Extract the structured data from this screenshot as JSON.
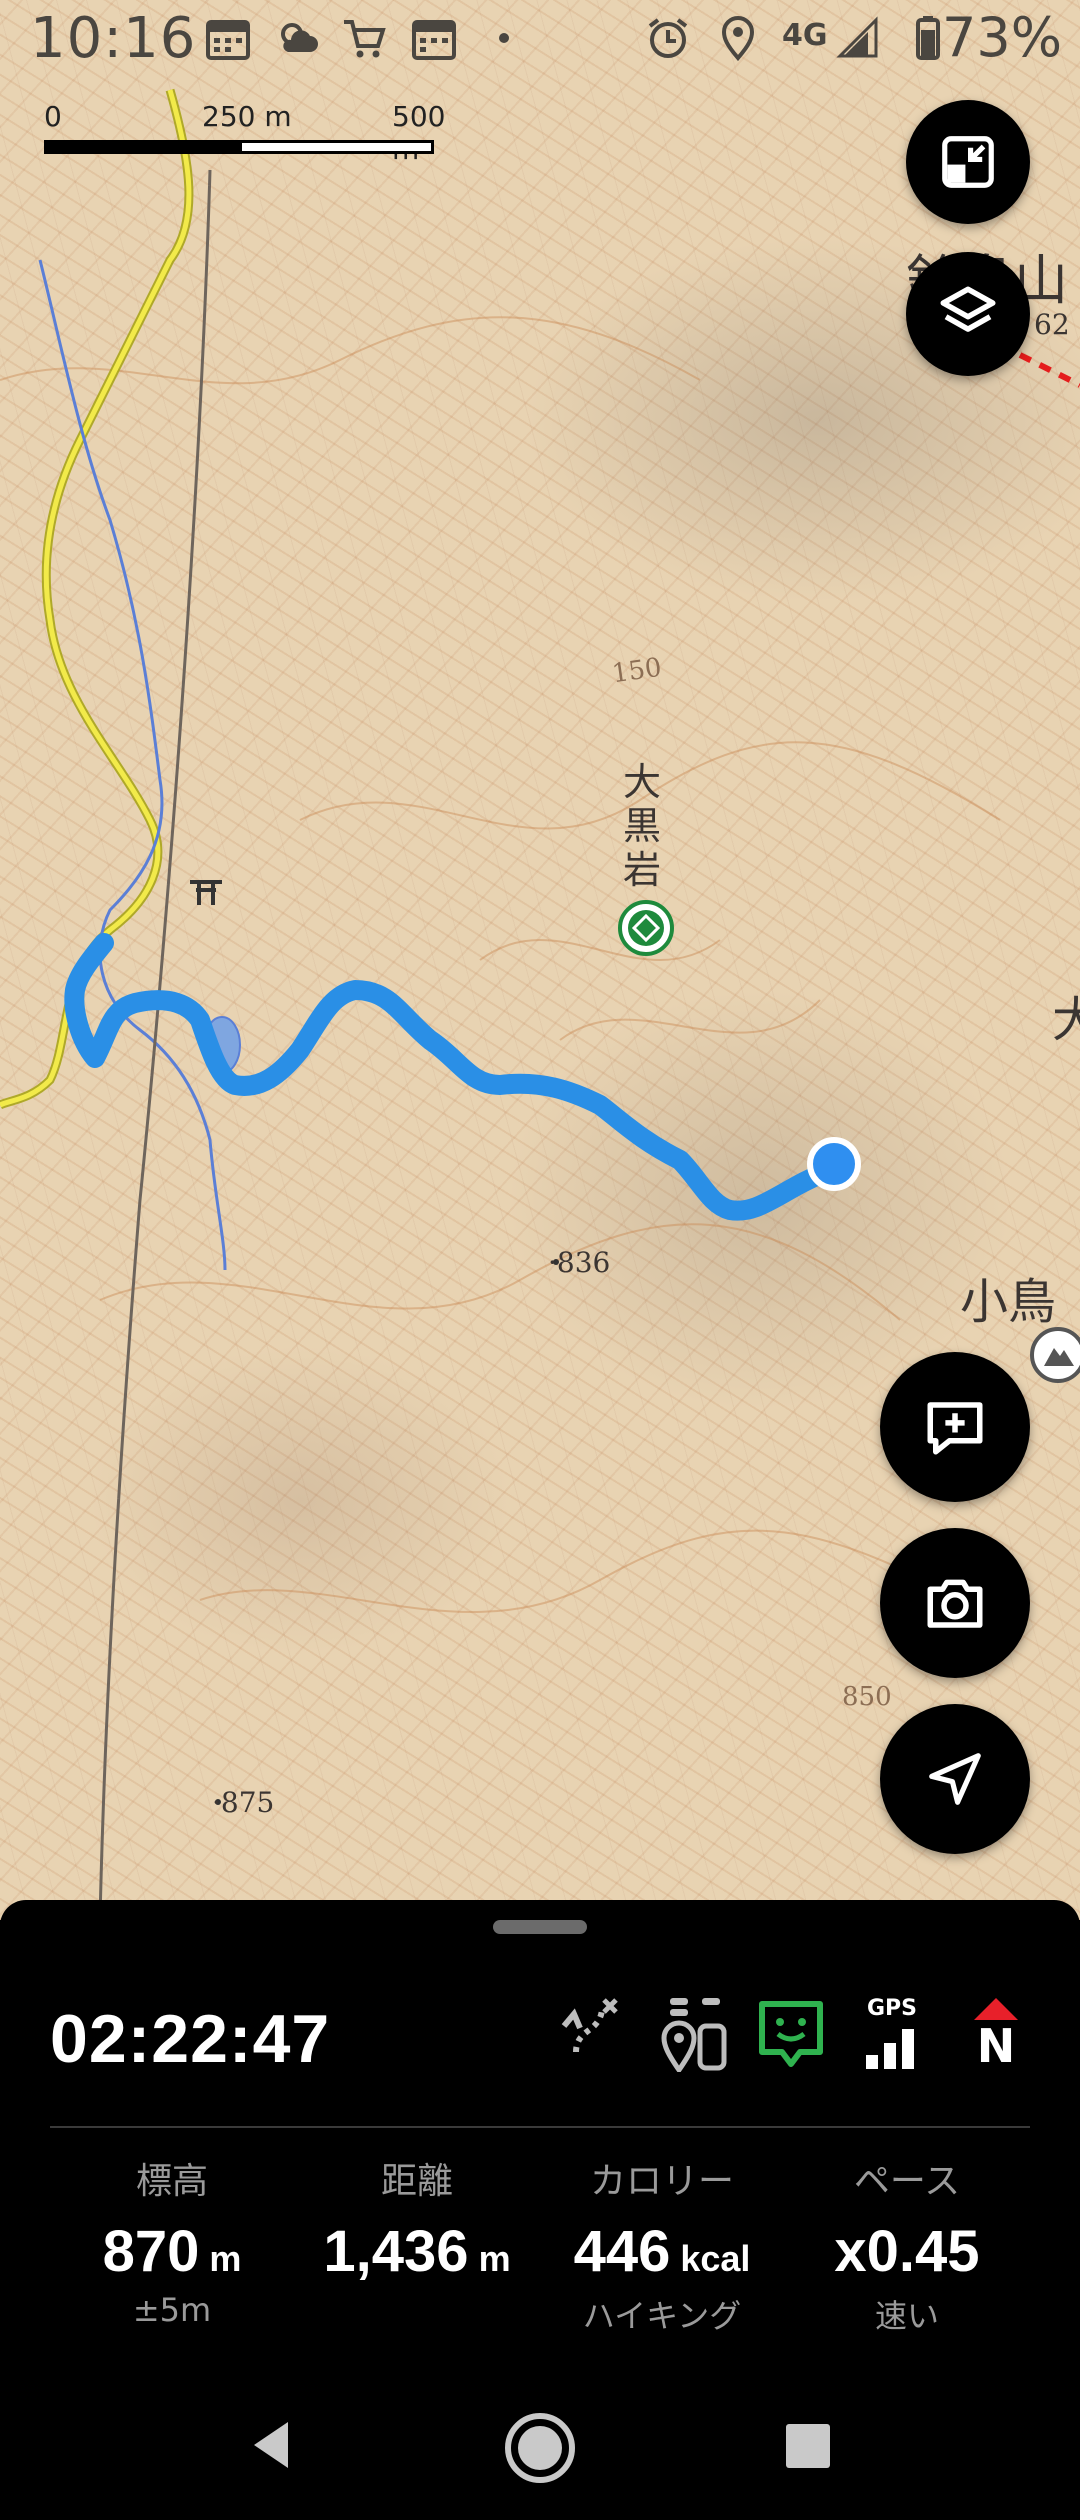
{
  "status_bar": {
    "time": "10:16",
    "network": "4G",
    "battery": "73%",
    "icons": [
      "calendar-icon",
      "weather-icon",
      "cart-icon",
      "calendar-icon",
      "dot-icon",
      "alarm-icon",
      "location-icon",
      "signal-icon",
      "battery-icon"
    ]
  },
  "map": {
    "scale": {
      "start": "0",
      "mid": "250 m",
      "end": "500 m"
    },
    "labels": {
      "peak_top": "鈴鳥山",
      "peak_top_elev": "62",
      "rock": "大黒岩",
      "rock_v": [
        "大",
        "黒",
        "岩"
      ],
      "contour_150": "150",
      "spot_836": "·836",
      "spot_875": "·875",
      "kotori": "小鳥",
      "edge_char": "大",
      "contour_850": "850"
    },
    "track_color": "#2a8fe6",
    "position_color": "#2f8ff0"
  },
  "buttons": {
    "exit_fullscreen": "exit-fullscreen-icon",
    "layers": "layers-icon",
    "add_note": "add-note-icon",
    "camera": "camera-icon",
    "navigate": "navigation-arrow-icon"
  },
  "panel": {
    "timer": "02:22:47",
    "tools": {
      "route": "route-icon",
      "members": "members-icon",
      "face": "smile-icon",
      "gps_label": "GPS",
      "compass_label": "N"
    },
    "stats": [
      {
        "label": "標高",
        "value": "870",
        "unit": "m",
        "sub": "±5m"
      },
      {
        "label": "距離",
        "value": "1,436",
        "unit": "m",
        "sub": ""
      },
      {
        "label": "カロリー",
        "value": "446",
        "unit": "kcal",
        "sub": "ハイキング"
      },
      {
        "label": "ペース",
        "value": "x0.45",
        "unit": "",
        "sub": "速い"
      }
    ],
    "accent_green": "#2fb24f",
    "accent_red": "#e8202a"
  },
  "navbar": {
    "back": "back-icon",
    "home": "home-icon",
    "recents": "recents-icon"
  }
}
